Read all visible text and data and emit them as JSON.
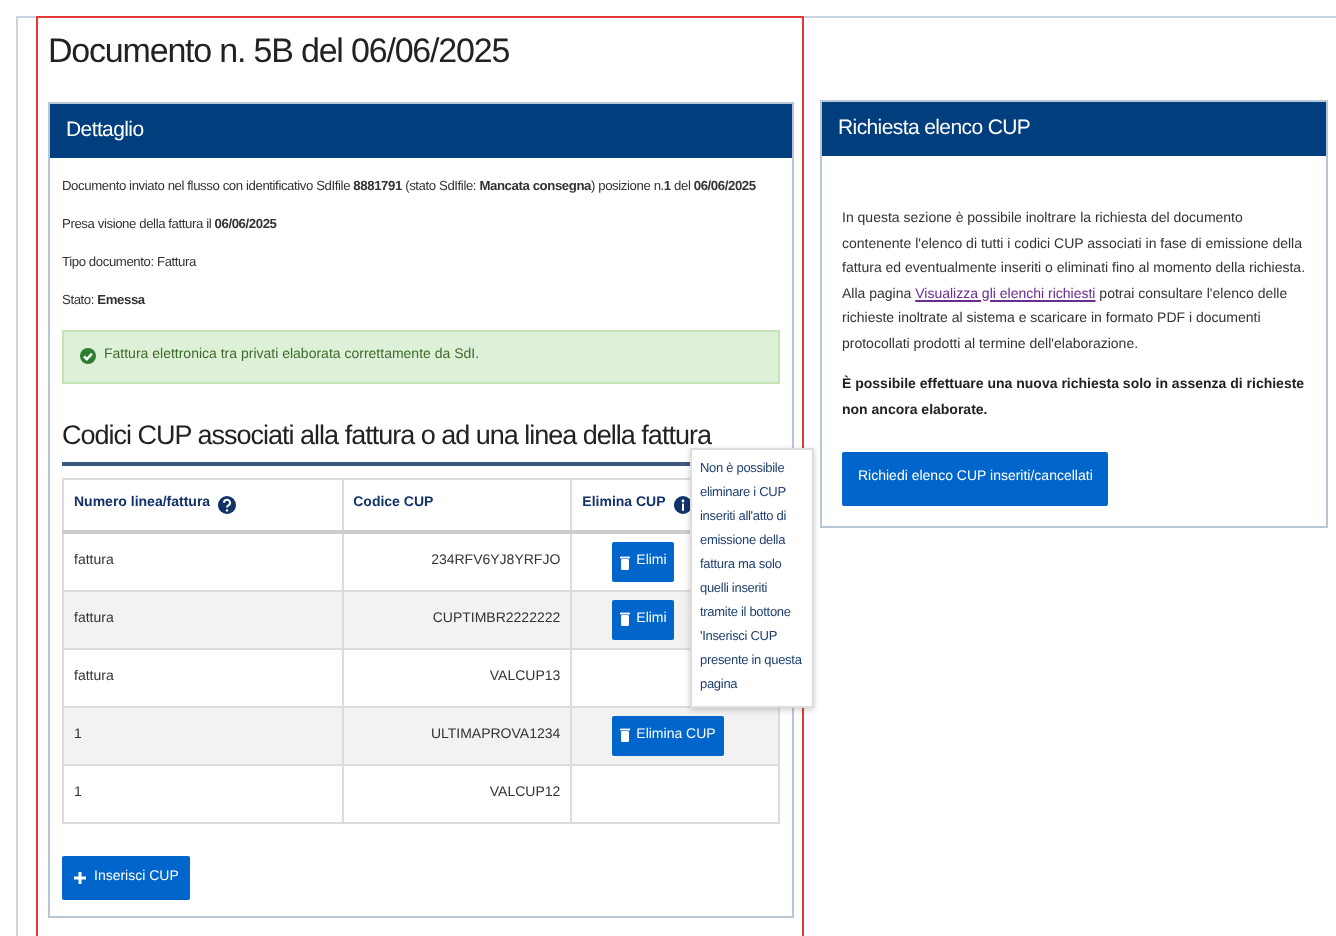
{
  "page": {
    "title": "Documento n. 5B del 06/06/2025"
  },
  "detail": {
    "header": "Dettaglio",
    "lines": [
      "Documento inviato nel flusso con identificativo SdIfile **8881791** (stato SdIfile: **Mancata consegna**) posizione n.**1** del **06/06/2025**",
      "Presa visione della fattura il **06/06/2025**",
      "Tipo documento: Fattura",
      "Stato: **Emessa**"
    ],
    "alert": {
      "kind": "success",
      "text": "Fattura elettronica tra privati elaborata correttamente da SdI."
    }
  },
  "cup_section": {
    "title": "Codici CUP associati alla fattura o ad una linea della fattura",
    "columns": [
      {
        "label": "Numero linea/fattura",
        "kind": "help"
      },
      {
        "label": "Codice CUP"
      },
      {
        "label": "Elimina CUP",
        "kind": "info"
      }
    ],
    "rows": [
      {
        "line": "fattura",
        "code": "234RFV6YJ8YRFJO",
        "action": "Elimi"
      },
      {
        "line": "fattura",
        "code": "CUPTIMBR2222222",
        "action": "Elimi"
      },
      {
        "line": "fattura",
        "code": "VALCUP13"
      },
      {
        "line": "1",
        "code": "ULTIMAPROVA1234",
        "action": "Elimina CUP"
      },
      {
        "line": "1",
        "code": "VALCUP12"
      }
    ],
    "tooltip": "Non è possibile eliminare i CUP inseriti all'atto di emissione della fattura ma solo quelli inseriti tramite il bottone 'Inserisci CUP presente in questa pagina",
    "add_button": "Inserisci CUP"
  },
  "request_card": {
    "header": "Richiesta elenco CUP",
    "text_before": "In questa sezione è possibile inoltrare la richiesta del documento contenente l'elenco di tutti i codici CUP associati in fase di emissione della fattura ed eventualmente inseriti o eliminati fino al momento della richiesta. Alla pagina",
    "link": "Visualizza gli elenchi richiesti",
    "text_after": "potrai consultare l'elenco delle richieste inoltrate al sistema e scaricare in formato PDF i documenti protocollati prodotti al termine dell'elaborazione.",
    "note": "È possibile effettuare una nuova richiesta solo in assenza di richieste non ancora elaborate.",
    "button": "Richiedi elenco CUP inseriti/cancellati"
  }
}
